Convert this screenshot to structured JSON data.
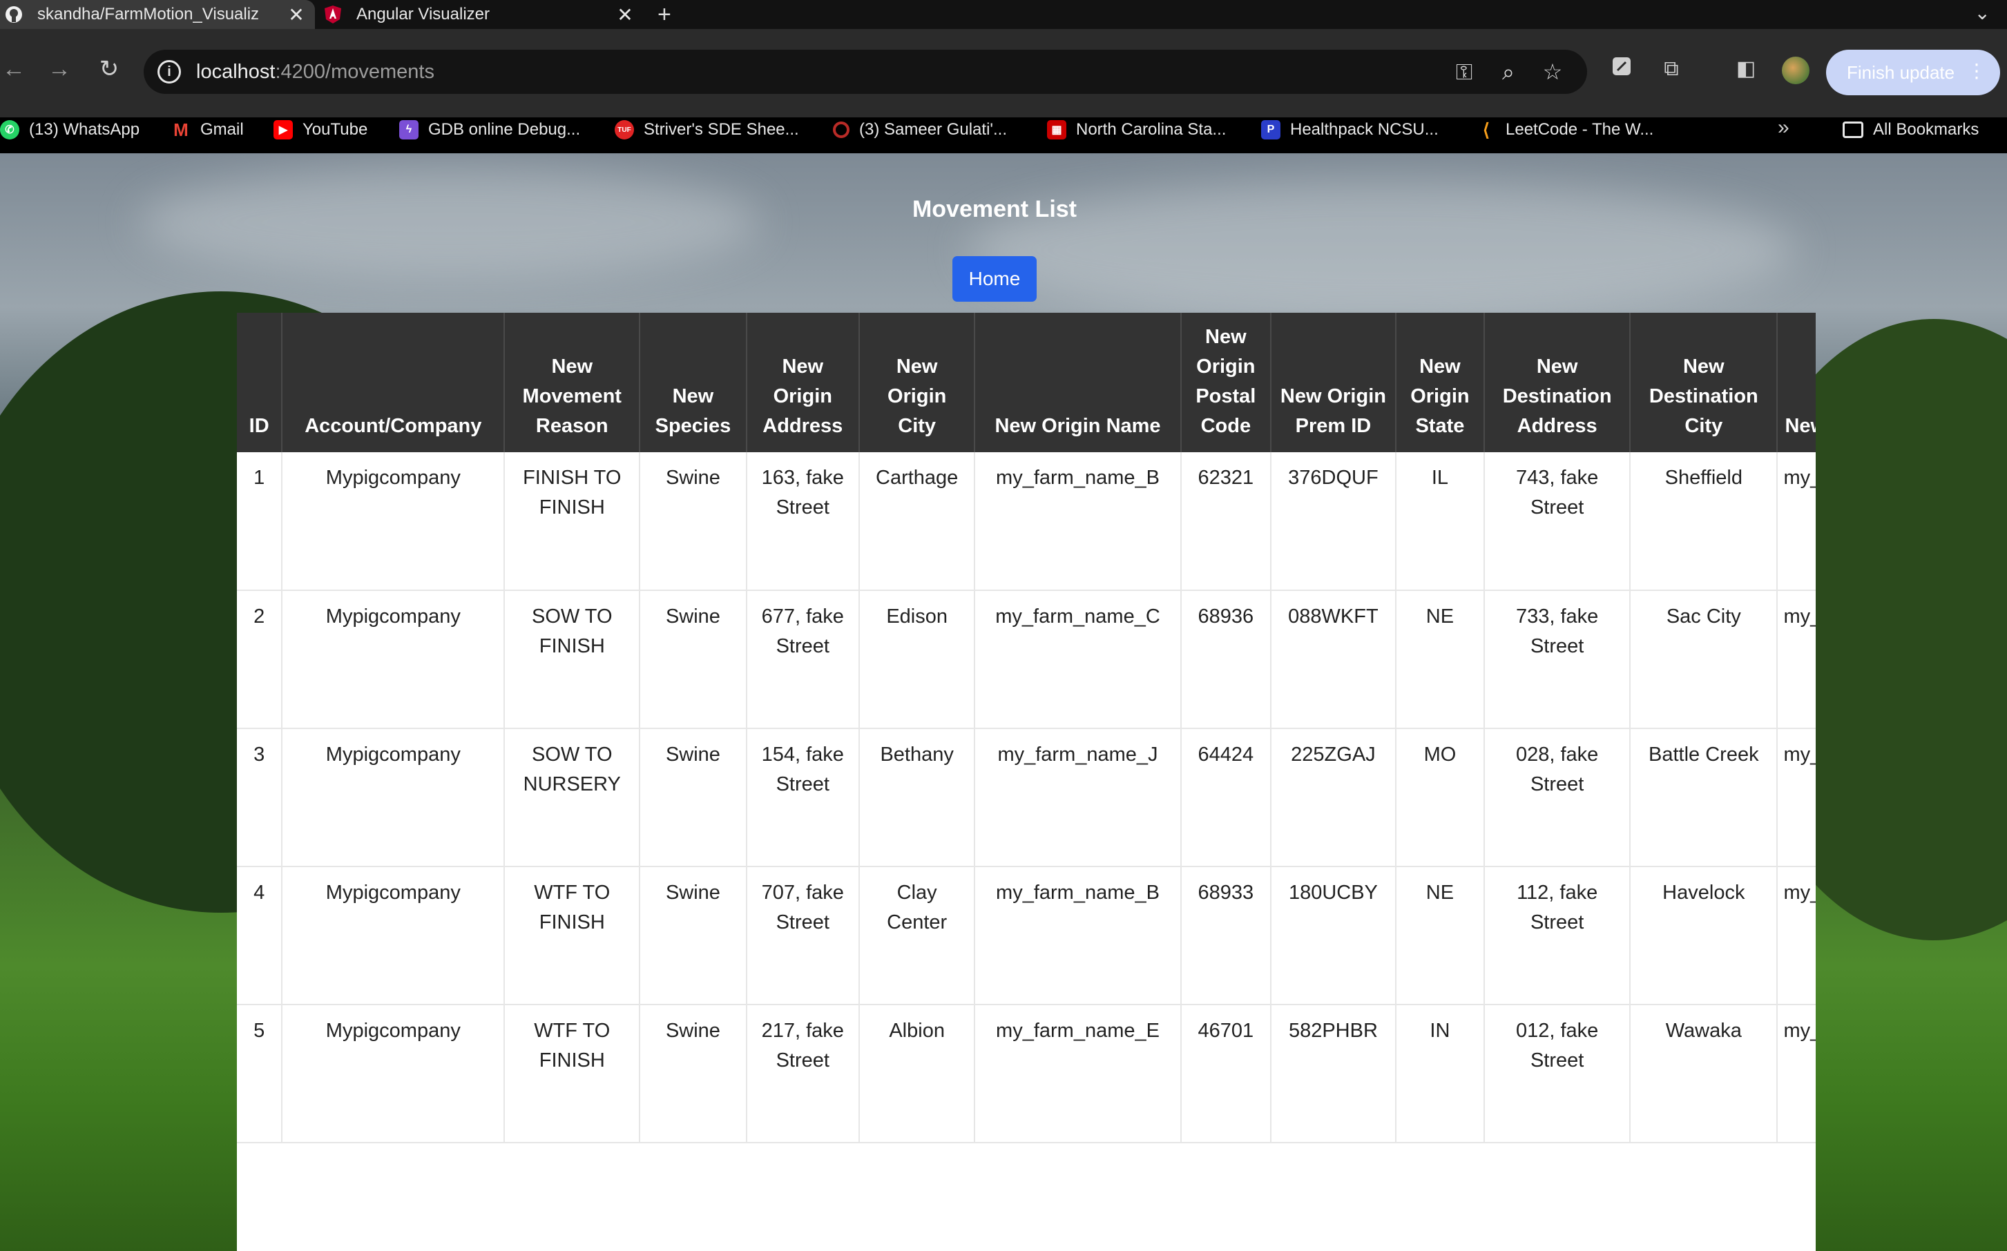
{
  "browser": {
    "tabs": [
      {
        "title": "skandha/FarmMotion_Visualiz",
        "active": true,
        "icon": "github-icon"
      },
      {
        "title": "Angular Visualizer",
        "active": false,
        "icon": "angular-icon"
      }
    ],
    "url_host": "localhost",
    "url_path": ":4200/movements",
    "update_label": "Finish update",
    "bookmarks": [
      {
        "label": "(13) WhatsApp",
        "icon": "whatsapp-icon",
        "color": "#25d366"
      },
      {
        "label": "Gmail",
        "icon": "gmail-icon",
        "color": "#ea4335"
      },
      {
        "label": "YouTube",
        "icon": "youtube-icon",
        "color": "#ff0000"
      },
      {
        "label": "GDB online Debug...",
        "icon": "gdb-icon",
        "color": "#7b4fd6"
      },
      {
        "label": "Striver's SDE Shee...",
        "icon": "striver-icon",
        "color": "#e02424"
      },
      {
        "label": "(3) Sameer Gulati'...",
        "icon": "quora-icon",
        "color": "#b92b27"
      },
      {
        "label": "North Carolina Sta...",
        "icon": "ncsu-icon",
        "color": "#cc0000"
      },
      {
        "label": "Healthpack NCSU...",
        "icon": "healthpack-icon",
        "color": "#2a3ec9"
      },
      {
        "label": "LeetCode - The W...",
        "icon": "leetcode-icon",
        "color": "#f89f1b"
      }
    ],
    "all_bookmarks": "All Bookmarks"
  },
  "page": {
    "title": "Movement List",
    "home_button": "Home"
  },
  "table": {
    "headers": [
      "ID",
      "Account/Company",
      "New Movement Reason",
      "New Species",
      "New Origin Address",
      "New Origin City",
      "New Origin Name",
      "New Origin Postal Code",
      "New Origin Prem ID",
      "New Origin State",
      "New Destination Address",
      "New Destination City",
      "New Destination Name"
    ],
    "rows": [
      [
        "1",
        "Mypigcompany",
        "FINISH TO FINISH",
        "Swine",
        "163, fake Street",
        "Carthage",
        "my_farm_name_B",
        "62321",
        "376DQUF",
        "IL",
        "743, fake Street",
        "Sheffield",
        "my_farm_name_"
      ],
      [
        "2",
        "Mypigcompany",
        "SOW TO FINISH",
        "Swine",
        "677, fake Street",
        "Edison",
        "my_farm_name_C",
        "68936",
        "088WKFT",
        "NE",
        "733, fake Street",
        "Sac City",
        "my_farm_name_"
      ],
      [
        "3",
        "Mypigcompany",
        "SOW TO NURSERY",
        "Swine",
        "154, fake Street",
        "Bethany",
        "my_farm_name_J",
        "64424",
        "225ZGAJ",
        "MO",
        "028, fake Street",
        "Battle Creek",
        "my_farm_name_"
      ],
      [
        "4",
        "Mypigcompany",
        "WTF TO FINISH",
        "Swine",
        "707, fake Street",
        "Clay Center",
        "my_farm_name_B",
        "68933",
        "180UCBY",
        "NE",
        "112, fake Street",
        "Havelock",
        "my_farm_name_"
      ],
      [
        "5",
        "Mypigcompany",
        "WTF TO FINISH",
        "Swine",
        "217, fake Street",
        "Albion",
        "my_farm_name_E",
        "46701",
        "582PHBR",
        "IN",
        "012, fake Street",
        "Wawaka",
        "my_farm_name_"
      ]
    ]
  }
}
